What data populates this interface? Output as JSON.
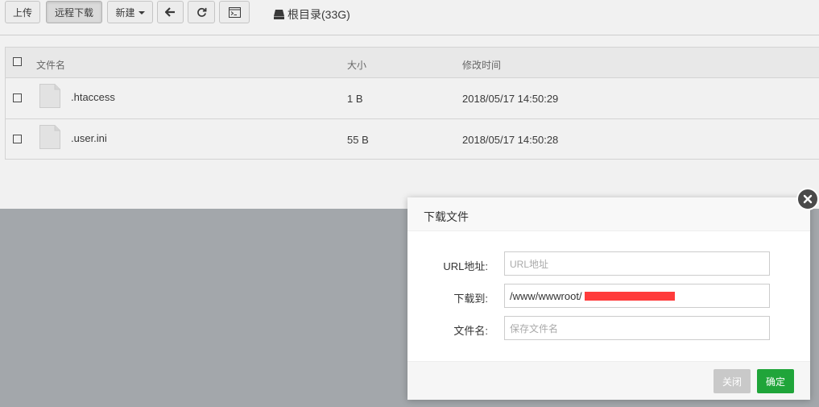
{
  "toolbar": {
    "upload_label": "上传",
    "remote_download_label": "远程下载",
    "new_label": "新建",
    "path_label": "根目录(33G)"
  },
  "table": {
    "columns": [
      "文件名",
      "大小",
      "修改时间"
    ],
    "rows": [
      {
        "name": ".htaccess",
        "size": "1 B",
        "modified": "2018/05/17 14:50:29"
      },
      {
        "name": ".user.ini",
        "size": "55 B",
        "modified": "2018/05/17 14:50:28"
      }
    ]
  },
  "dialog": {
    "title": "下载文件",
    "url_label": "URL地址:",
    "url_placeholder": "URL地址",
    "url_value": "",
    "dest_label": "下载到:",
    "dest_value": "/www/wwwroot/",
    "filename_label": "文件名:",
    "filename_placeholder": "保存文件名",
    "filename_value": "",
    "close_label": "关闭",
    "confirm_label": "确定"
  },
  "colors": {
    "confirm": "#20a53a",
    "redaction": "#ff3b3b",
    "disabled": "#c9c9c9"
  }
}
